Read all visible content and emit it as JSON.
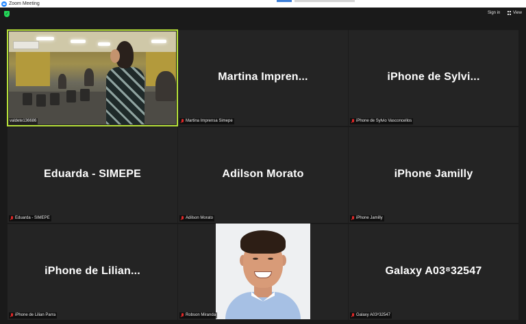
{
  "window": {
    "title": "Zoom Meeting"
  },
  "topbar": {
    "sign_in": "Sign in",
    "view": "View"
  },
  "tiles": [
    {
      "label": "valdete136686",
      "name": "",
      "muted": false,
      "active": true,
      "video": true
    },
    {
      "label": "Martina Imprensa Simepe",
      "name": "Martina  Impren...",
      "muted": true
    },
    {
      "label": "iPhone de Sylvio Vasconcellos",
      "name": "iPhone de Sylvi...",
      "muted": true
    },
    {
      "label": "Eduarda - SIMEPE",
      "name": "Eduarda - SIMEPE",
      "muted": true
    },
    {
      "label": "Adilson Morato",
      "name": "Adilson Morato",
      "muted": true
    },
    {
      "label": "iPhone Jamilly",
      "name": "iPhone Jamilly",
      "muted": true
    },
    {
      "label": "iPhone de Lilian Parra",
      "name": "iPhone de Lilian...",
      "muted": true
    },
    {
      "label": "Robson Miranda",
      "name": "",
      "muted": true,
      "photo": true
    },
    {
      "label": "Galaxy A03⁸32547",
      "name": "Galaxy A03⁸32547",
      "muted": true
    }
  ],
  "colors": {
    "active_speaker": "#b8e23a",
    "muted_icon": "#e02828",
    "tile_bg": "#242424",
    "security_shield": "#23d959"
  }
}
